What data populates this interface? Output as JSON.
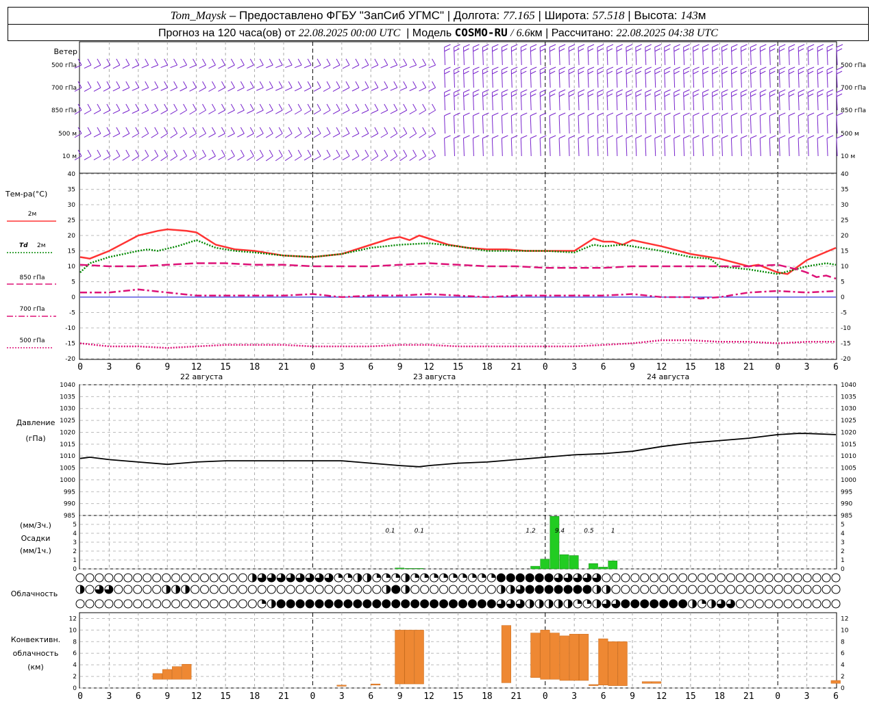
{
  "header": {
    "station": "Tom_Maysk",
    "provider": "– Предоставлено ФГБУ \"ЗапСиб УГМС\"",
    "lon_label": "Долгота:",
    "lon": "77.165",
    "lat_label": "Широта:",
    "lat": "57.518",
    "alt_label": "Высота:",
    "alt": "143",
    "alt_unit": "м",
    "forecast_prefix": "Прогноз на 120 часа(ов) от",
    "init_time": "22.08.2025 00:00 UTC",
    "model_label": "Модель",
    "model": "COSMO-RU",
    "model_res": "/ 6.6",
    "model_res_unit": "км",
    "calc_label": "Рассчитано:",
    "calc_time": "22.08.2025 04:38 UTC"
  },
  "labels": {
    "wind": "Ветер",
    "wind_levels": [
      "500 гПа",
      "700 гПа",
      "850 гПа",
      "500 м",
      "10 м"
    ],
    "temp_title": "Тем-ра(°С)",
    "t2m": "2м",
    "td_prefix": "Td",
    "td_suffix": "2м",
    "t850": "850 гПа",
    "t700": "700 гПа",
    "t500": "500 гПа",
    "day1": "22 августа",
    "day2": "23 августа",
    "day3": "24 августа",
    "pressure_title": "Давление",
    "pressure_unit": "(гПа)",
    "precip_unit1": "(мм/3ч.)",
    "precip_title": "Осадки",
    "precip_unit2": "(мм/1ч.)",
    "cloud_title": "Облачность",
    "conv_title1": "Конвективн.",
    "conv_title2": "облачность",
    "conv_unit": "(км)"
  },
  "colors": {
    "t2m": "#ff3333",
    "td2m": "#008800",
    "t850": "#dd1177",
    "t700": "#dd1177",
    "t500": "#dd1177",
    "wind": "#7722cc",
    "precip": "#22cc22",
    "conv": "#ee8833",
    "pressure": "#000000"
  },
  "chart_data": [
    {
      "type": "line",
      "title": "Тем-ра(°С)",
      "x_hours": [
        0,
        3,
        6,
        9,
        12,
        15,
        18,
        21,
        24,
        27,
        30,
        33,
        36,
        39,
        42,
        45,
        48,
        51,
        54,
        57,
        60,
        63,
        66,
        69,
        72,
        75,
        78
      ],
      "x_tick_labels": [
        "0",
        "3",
        "6",
        "9",
        "12",
        "15",
        "18",
        "21",
        "0",
        "3",
        "6",
        "9",
        "12",
        "15",
        "18",
        "21",
        "0",
        "3",
        "6",
        "9",
        "12",
        "15",
        "18",
        "21",
        "0",
        "3",
        "6"
      ],
      "ylim": [
        -20,
        40
      ],
      "y_ticks": [
        -20,
        -15,
        -10,
        -5,
        0,
        5,
        10,
        15,
        20,
        25,
        30,
        35,
        40
      ],
      "series": [
        {
          "name": "2м",
          "x": [
            0,
            1,
            3,
            6,
            8,
            9,
            11,
            12,
            14,
            16,
            18,
            21,
            24,
            27,
            30,
            32,
            33,
            34,
            35,
            36,
            38,
            40,
            42,
            44,
            46,
            48,
            51,
            53,
            54,
            55,
            56,
            57,
            60,
            63,
            66,
            69,
            70,
            72,
            73,
            75,
            78
          ],
          "values": [
            13,
            12.5,
            15,
            20,
            21.5,
            22,
            21.5,
            21,
            17,
            15.5,
            15,
            13.5,
            13,
            14,
            17,
            19,
            19.5,
            18.5,
            20,
            19,
            17,
            16,
            15.5,
            15.5,
            15,
            15,
            15,
            19,
            18,
            18,
            17,
            18.5,
            16.5,
            14,
            12.5,
            10,
            10.5,
            8,
            7.5,
            12,
            16
          ]
        },
        {
          "name": "Td 2м",
          "x": [
            0,
            1,
            3,
            6,
            7,
            8,
            10,
            12,
            14,
            16,
            18,
            21,
            24,
            27,
            30,
            33,
            36,
            39,
            42,
            45,
            48,
            51,
            53,
            54,
            56,
            57,
            60,
            63,
            65,
            66,
            69,
            72,
            75,
            77,
            78
          ],
          "values": [
            8,
            11,
            13,
            15,
            15.5,
            15,
            16.5,
            18.5,
            16,
            15,
            14.5,
            13.5,
            13,
            14,
            16,
            17,
            17.5,
            16.5,
            15,
            15,
            15,
            14.5,
            17,
            16.5,
            17,
            16.5,
            15,
            13,
            12.5,
            10,
            9,
            7.5,
            10,
            11,
            10.5
          ]
        },
        {
          "name": "850 гПа",
          "x": [
            0,
            3,
            6,
            9,
            12,
            15,
            18,
            21,
            24,
            27,
            30,
            33,
            36,
            39,
            42,
            45,
            48,
            51,
            54,
            57,
            60,
            63,
            66,
            69,
            72,
            74,
            75,
            76,
            77,
            78
          ],
          "values": [
            10.5,
            10,
            10,
            10.5,
            11,
            11,
            10.5,
            10.5,
            10,
            10,
            10,
            10.5,
            11,
            10.5,
            10,
            10,
            9.5,
            9.5,
            9.5,
            10,
            10,
            10,
            10,
            10,
            10.5,
            9,
            8,
            6.5,
            7,
            6
          ]
        },
        {
          "name": "700 гПа",
          "x": [
            0,
            3,
            6,
            9,
            12,
            15,
            18,
            21,
            24,
            27,
            30,
            33,
            36,
            39,
            42,
            45,
            48,
            51,
            54,
            57,
            60,
            63,
            64,
            66,
            69,
            72,
            75,
            78
          ],
          "values": [
            1.5,
            1.5,
            2.5,
            1.5,
            0.5,
            0.5,
            0.5,
            0.5,
            1,
            0,
            0.5,
            0.5,
            1,
            0.5,
            0,
            0.5,
            0.5,
            0.5,
            0.5,
            1,
            0,
            0,
            -0.5,
            0,
            1.5,
            2,
            1.5,
            2
          ]
        },
        {
          "name": "500 гПа",
          "x": [
            0,
            3,
            6,
            9,
            12,
            15,
            18,
            21,
            24,
            27,
            30,
            33,
            36,
            39,
            42,
            45,
            48,
            51,
            54,
            57,
            60,
            63,
            66,
            69,
            72,
            75,
            78
          ],
          "values": [
            -15,
            -16,
            -16,
            -16.5,
            -16,
            -15.5,
            -15.5,
            -15.5,
            -16,
            -16,
            -16,
            -15.5,
            -15.5,
            -16,
            -16,
            -16,
            -16,
            -16,
            -15.5,
            -15,
            -14,
            -14,
            -14.5,
            -14.5,
            -15,
            -14.5,
            -14.5
          ]
        }
      ]
    },
    {
      "type": "line",
      "title": "Давление",
      "ylabel": "(гПа)",
      "ylim": [
        985,
        1040
      ],
      "y_ticks": [
        985,
        990,
        995,
        1000,
        1005,
        1010,
        1015,
        1020,
        1025,
        1030,
        1035,
        1040
      ],
      "x_tick_labels": [
        "0",
        "3",
        "6",
        "9",
        "12",
        "15",
        "18",
        "21",
        "0",
        "3",
        "6",
        "9",
        "12",
        "15",
        "18",
        "21",
        "0",
        "3",
        "6",
        "9",
        "12",
        "15",
        "18",
        "21",
        "0",
        "3",
        "6"
      ],
      "series": [
        {
          "name": "Давление",
          "x": [
            0,
            1,
            3,
            6,
            9,
            12,
            15,
            18,
            21,
            24,
            27,
            30,
            33,
            35,
            36,
            39,
            42,
            45,
            48,
            51,
            54,
            57,
            60,
            63,
            66,
            69,
            72,
            74,
            75,
            78
          ],
          "values": [
            1009,
            1009.5,
            1008.5,
            1007.5,
            1006.5,
            1007.5,
            1008,
            1008,
            1008,
            1008,
            1008,
            1007,
            1006,
            1005.5,
            1006,
            1007,
            1007.5,
            1008.5,
            1009.5,
            1010.5,
            1011,
            1012,
            1014,
            1015.5,
            1016.5,
            1017.5,
            1019,
            1019.5,
            1019.5,
            1019
          ]
        }
      ]
    },
    {
      "type": "bar",
      "title": "Осадки",
      "ylim": [
        0,
        6
      ],
      "y_ticks": [
        0,
        1,
        2,
        3,
        4,
        5
      ],
      "bars_x_hours": [
        33,
        34,
        35,
        47,
        48,
        49,
        50,
        51,
        53,
        54,
        55
      ],
      "bars_values": [
        0.1,
        0.05,
        0.05,
        0.3,
        1.1,
        5.9,
        1.6,
        1.5,
        0.6,
        0.2,
        0.9
      ],
      "annotations": [
        {
          "x": 32,
          "text": "0.1"
        },
        {
          "x": 35,
          "text": "0.1"
        },
        {
          "x": 46.5,
          "text": "1.2"
        },
        {
          "x": 49.5,
          "text": "9.4"
        },
        {
          "x": 52.5,
          "text": "0.5"
        },
        {
          "x": 55,
          "text": "1"
        }
      ]
    },
    {
      "type": "bar",
      "title": "Конвективн. облачность",
      "ylabel": "(км)",
      "ylim": [
        0,
        13
      ],
      "y_ticks": [
        0,
        2,
        4,
        6,
        8,
        10,
        12
      ],
      "bars": [
        {
          "x": 8,
          "bottom": 1.5,
          "top": 2.5
        },
        {
          "x": 9,
          "bottom": 1.5,
          "top": 3.2
        },
        {
          "x": 10,
          "bottom": 1.5,
          "top": 3.7
        },
        {
          "x": 11,
          "bottom": 1.5,
          "top": 4.1
        },
        {
          "x": 27,
          "bottom": 0.3,
          "top": 0.5
        },
        {
          "x": 30.5,
          "bottom": 0.5,
          "top": 0.7
        },
        {
          "x": 33,
          "bottom": 0.7,
          "top": 10
        },
        {
          "x": 34,
          "bottom": 0.7,
          "top": 10
        },
        {
          "x": 35,
          "bottom": 0.7,
          "top": 10
        },
        {
          "x": 44,
          "bottom": 0.9,
          "top": 10.8
        },
        {
          "x": 47,
          "bottom": 1.8,
          "top": 9.5
        },
        {
          "x": 48,
          "bottom": 1.5,
          "top": 10
        },
        {
          "x": 49,
          "bottom": 1.5,
          "top": 9.5
        },
        {
          "x": 50,
          "bottom": 1.3,
          "top": 9
        },
        {
          "x": 51,
          "bottom": 1.3,
          "top": 9.3
        },
        {
          "x": 52,
          "bottom": 1.3,
          "top": 9.3
        },
        {
          "x": 53,
          "bottom": 0.4,
          "top": 0.6
        },
        {
          "x": 54,
          "bottom": 0.5,
          "top": 8.5
        },
        {
          "x": 55,
          "bottom": 0.4,
          "top": 8
        },
        {
          "x": 56,
          "bottom": 0.4,
          "top": 8
        },
        {
          "x": 58.5,
          "bottom": 0.8,
          "top": 1.1
        },
        {
          "x": 59.5,
          "bottom": 0.8,
          "top": 1.1
        },
        {
          "x": 78,
          "bottom": 0.8,
          "top": 1.3
        }
      ]
    },
    {
      "type": "table",
      "title": "Облачность",
      "rows": [
        {
          "name": "upper",
          "cover_percent": [
            0,
            0,
            0,
            0,
            0,
            0,
            0,
            0,
            0,
            0,
            0,
            0,
            0,
            0,
            0,
            0,
            0,
            0,
            50,
            75,
            75,
            75,
            75,
            75,
            75,
            75,
            75,
            25,
            25,
            50,
            50,
            25,
            25,
            25,
            50,
            25,
            25,
            25,
            25,
            25,
            25,
            25,
            25,
            25,
            100,
            100,
            100,
            100,
            100,
            100,
            75,
            75,
            75,
            75,
            75,
            0,
            0,
            0,
            0,
            0,
            0,
            0,
            0,
            0,
            0,
            0,
            0,
            0,
            0,
            0,
            0,
            0,
            0,
            0,
            0,
            0,
            0,
            0,
            0,
            0
          ]
        },
        {
          "name": "middle",
          "cover_percent": [
            50,
            0,
            75,
            75,
            0,
            0,
            0,
            0,
            0,
            50,
            50,
            50,
            0,
            0,
            0,
            0,
            0,
            0,
            0,
            0,
            0,
            0,
            0,
            0,
            0,
            0,
            0,
            0,
            0,
            0,
            0,
            0,
            50,
            100,
            50,
            0,
            0,
            0,
            0,
            0,
            0,
            0,
            0,
            0,
            50,
            50,
            75,
            100,
            100,
            100,
            100,
            100,
            100,
            100,
            50,
            50,
            0,
            0,
            0,
            0,
            0,
            0,
            0,
            0,
            0,
            0,
            0,
            0,
            0,
            0,
            0,
            0,
            0,
            0,
            0,
            0,
            0,
            0,
            0,
            0
          ]
        },
        {
          "name": "lower",
          "cover_percent": [
            0,
            0,
            0,
            0,
            0,
            0,
            0,
            0,
            0,
            0,
            0,
            0,
            0,
            0,
            0,
            0,
            0,
            0,
            0,
            25,
            50,
            100,
            100,
            100,
            100,
            100,
            100,
            100,
            100,
            100,
            100,
            100,
            100,
            100,
            100,
            100,
            100,
            100,
            100,
            100,
            100,
            100,
            100,
            100,
            75,
            75,
            75,
            50,
            50,
            50,
            50,
            50,
            25,
            25,
            50,
            75,
            75,
            100,
            100,
            100,
            100,
            100,
            100,
            100,
            50,
            25,
            50,
            75,
            75,
            0,
            0,
            0,
            0,
            0,
            0,
            0,
            0,
            0,
            0,
            0
          ]
        }
      ]
    }
  ]
}
